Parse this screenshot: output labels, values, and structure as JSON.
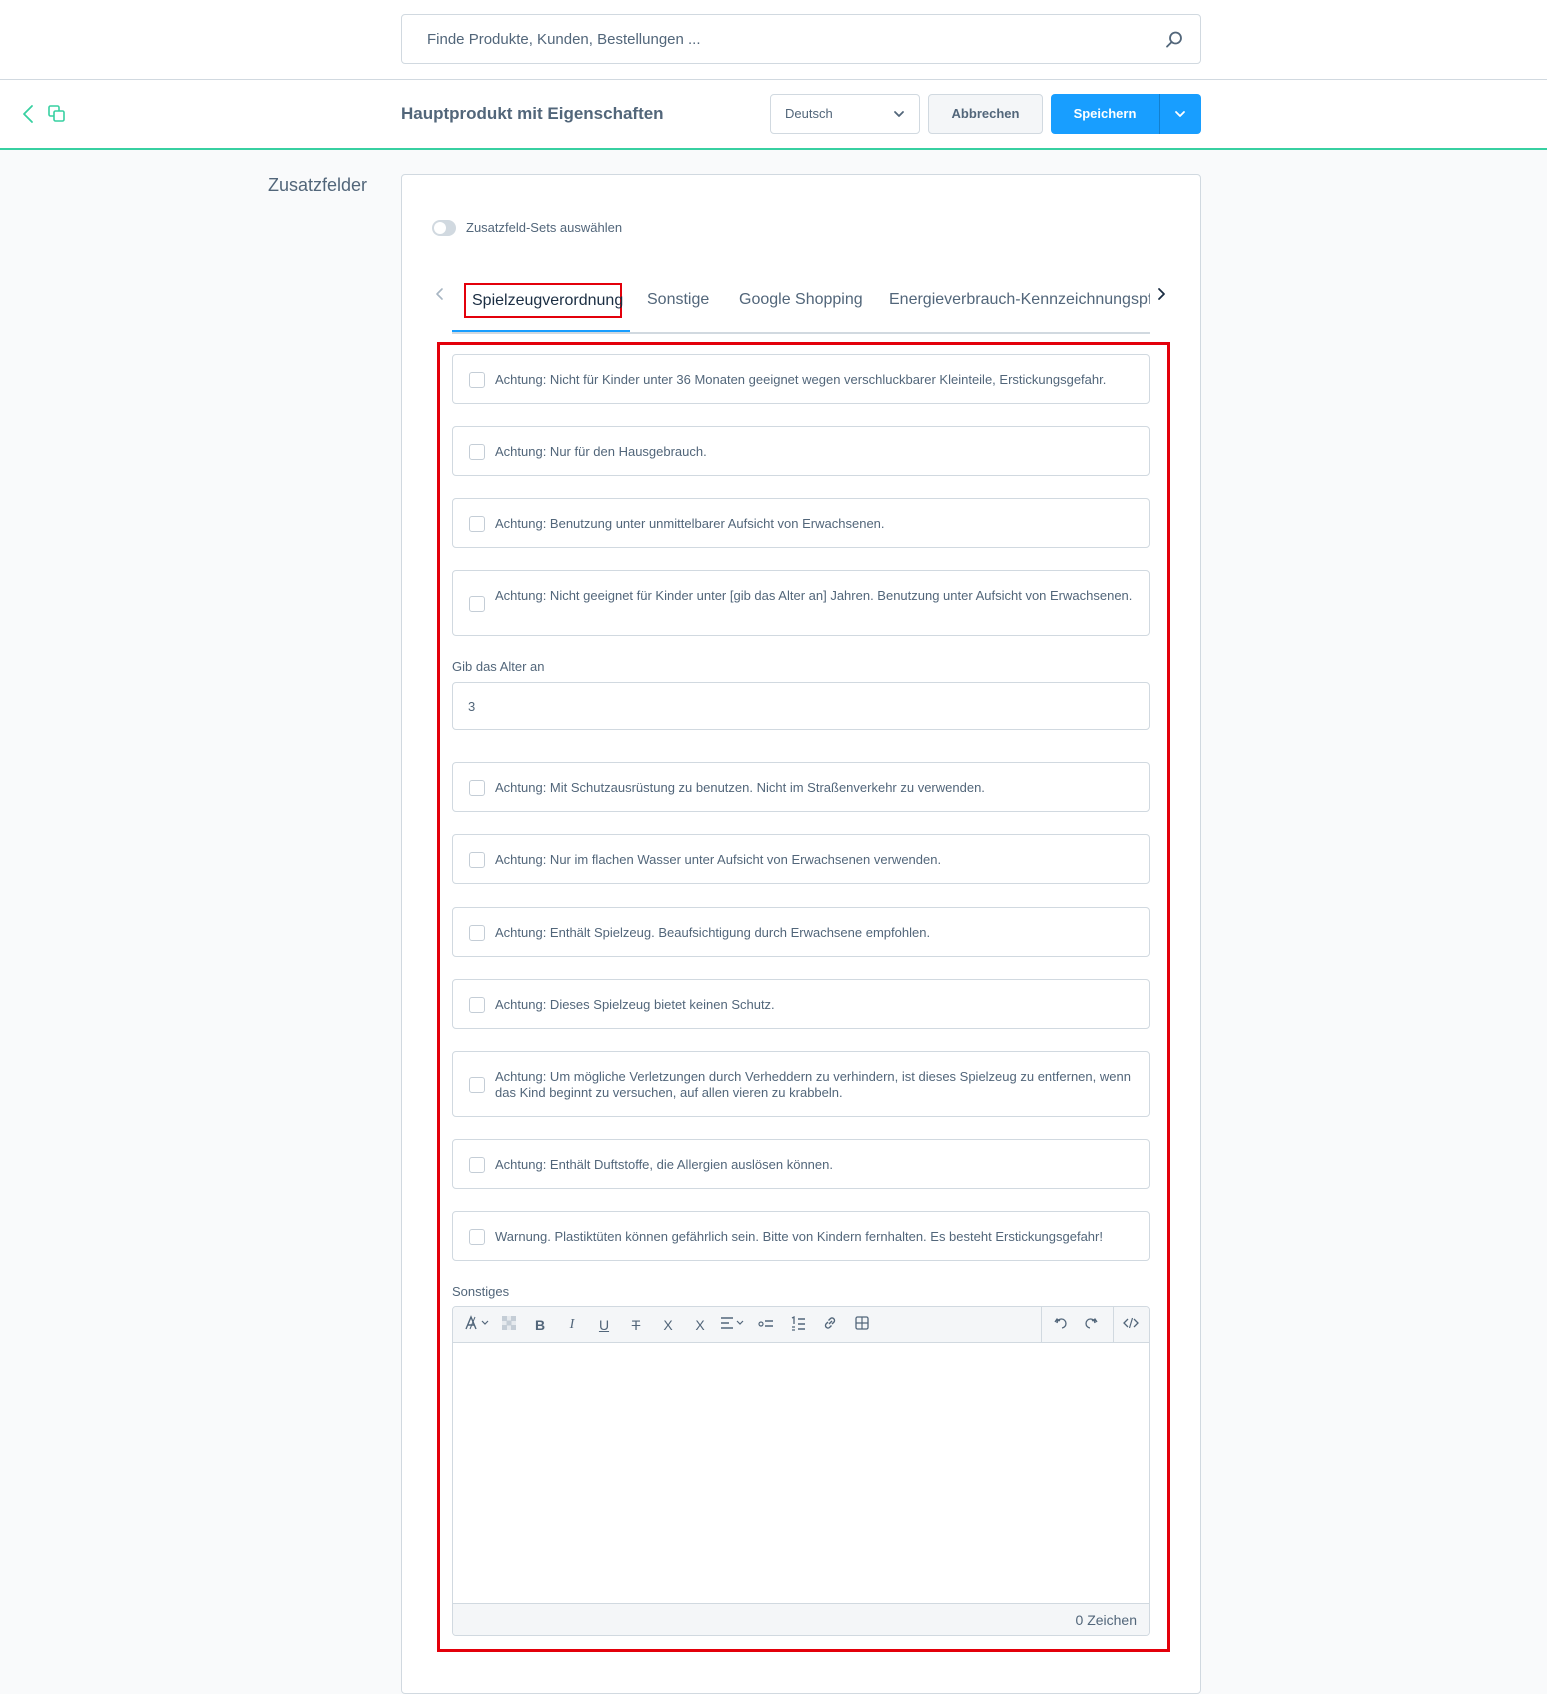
{
  "search": {
    "placeholder": "Finde Produkte, Kunden, Bestellungen ..."
  },
  "header": {
    "title": "Hauptprodukt mit Eigenschaften",
    "language": "Deutsch",
    "cancel_label": "Abbrechen",
    "save_label": "Speichern"
  },
  "section": {
    "label": "Zusatzfelder"
  },
  "toggle": {
    "label": "Zusatzfeld-Sets auswählen"
  },
  "tabs": [
    {
      "label": "Spielzeugverordnung"
    },
    {
      "label": "Sonstige"
    },
    {
      "label": "Google Shopping"
    },
    {
      "label": "Energieverbrauch-Kennzeichnungspflicht"
    }
  ],
  "checkboxes": [
    {
      "label": "Achtung: Nicht für Kinder unter 36 Monaten geeignet wegen verschluckbarer Kleinteile, Erstickungsgefahr."
    },
    {
      "label": "Achtung: Nur für den Hausgebrauch."
    },
    {
      "label": "Achtung: Benutzung unter unmittelbarer Aufsicht von Erwachsenen."
    },
    {
      "label": "Achtung: Nicht geeignet für Kinder unter [gib das Alter an] Jahren. Benutzung unter Aufsicht von Erwachsenen."
    },
    {
      "label": "Achtung: Mit Schutzausrüstung zu benutzen. Nicht im Straßenverkehr zu verwenden."
    },
    {
      "label": "Achtung: Nur im flachen Wasser unter Aufsicht von Erwachsenen verwenden."
    },
    {
      "label": "Achtung: Enthält Spielzeug. Beaufsichtigung durch Erwachsene empfohlen."
    },
    {
      "label": "Achtung: Dieses Spielzeug bietet keinen Schutz."
    },
    {
      "label": "Achtung: Um mögliche Verletzungen durch Verheddern zu verhindern, ist dieses Spielzeug zu entfernen, wenn das Kind beginnt zu versuchen, auf allen vieren zu krabbeln."
    },
    {
      "label": "Achtung: Enthält Duftstoffe, die Allergien auslösen können."
    },
    {
      "label": "Warnung. Plastiktüten können gefährlich sein. Bitte von Kindern fernhalten. Es besteht Erstickungsgefahr!"
    }
  ],
  "age_field": {
    "label": "Gib das Alter an",
    "value": "3"
  },
  "editor": {
    "label": "Sonstiges",
    "char_count": "0 Zeichen",
    "toolbar": {
      "bold": "B",
      "italic": "I",
      "underline": "U",
      "strike": "T",
      "superscript": "X",
      "subscript": "X"
    }
  }
}
